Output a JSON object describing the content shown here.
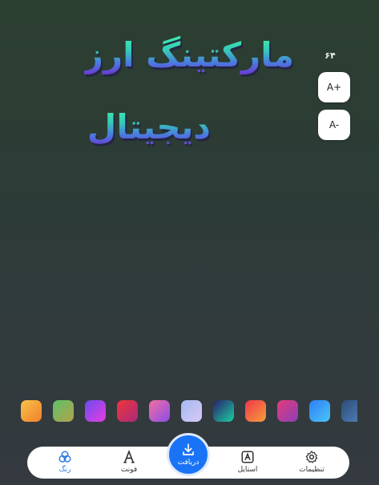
{
  "title": {
    "line1": "مارکتینگ ارز",
    "line2": "دیجیتال"
  },
  "font_size": {
    "value": "۶۴",
    "increase_label": "A+",
    "decrease_label": "A-"
  },
  "palette": [
    {
      "name": "orange",
      "from": "#f7c24a",
      "to": "#f2802a"
    },
    {
      "name": "green-olive",
      "from": "#5fc06a",
      "to": "#b1a34a"
    },
    {
      "name": "purple-pink",
      "from": "#6a4cf0",
      "to": "#e83ce0"
    },
    {
      "name": "red-crimson",
      "from": "#f0353a",
      "to": "#a82a7a"
    },
    {
      "name": "pink-purple",
      "from": "#f36fa2",
      "to": "#8a4de6"
    },
    {
      "name": "lavender",
      "from": "#a5b8f2",
      "to": "#d8c9f4"
    },
    {
      "name": "navy-teal",
      "from": "#2a1e6e",
      "to": "#1bd0a0"
    },
    {
      "name": "red-orange",
      "from": "#f0364a",
      "to": "#f5a03c"
    },
    {
      "name": "magenta",
      "from": "#e53b7a",
      "to": "#8a3fb8"
    },
    {
      "name": "blue",
      "from": "#2f7ef5",
      "to": "#49c6f7"
    },
    {
      "name": "slate-blue",
      "from": "#2c4c78",
      "to": "#4d7bb0"
    }
  ],
  "nav": {
    "color": {
      "label": "رنگ",
      "icon": "color-circles-icon"
    },
    "font": {
      "label": "فونت",
      "icon": "font-icon"
    },
    "download": {
      "label": "دریافت",
      "icon": "download-icon"
    },
    "style": {
      "label": "استایل",
      "icon": "style-icon"
    },
    "settings": {
      "label": "تنظیمات",
      "icon": "gear-icon"
    }
  },
  "colors": {
    "accent": "#1a73f5",
    "active_nav": "#2f7be0"
  }
}
